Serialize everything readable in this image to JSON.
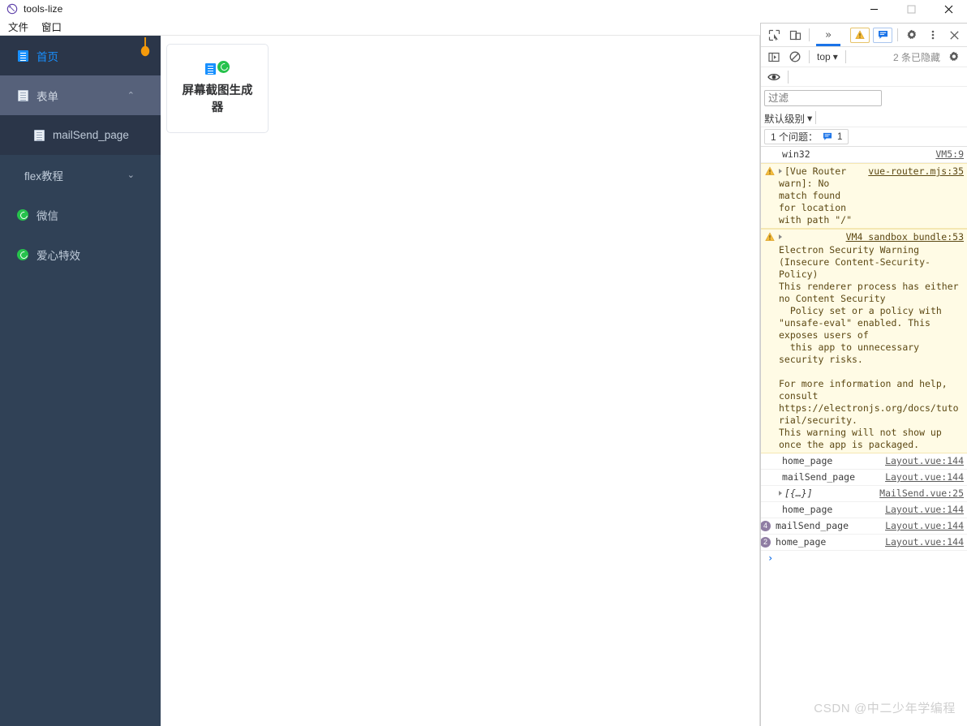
{
  "window": {
    "title": "tools-lize",
    "icon": "app-logo-icon",
    "controls": {
      "minimize": "—",
      "maximize": "☐",
      "close": "✕"
    }
  },
  "menubar": {
    "items": [
      "文件",
      "窗口"
    ]
  },
  "sidebar": {
    "items": [
      {
        "label": "首页",
        "icon": "document-icon",
        "state": "active"
      },
      {
        "label": "表单",
        "icon": "document-icon",
        "state": "group-open",
        "caret": "⌃"
      },
      {
        "label": "mailSend_page",
        "icon": "document-icon",
        "state": "sub"
      },
      {
        "label": "flex教程",
        "icon": "none",
        "state": "plain",
        "caret": "⌄"
      },
      {
        "label": "微信",
        "icon": "wechat-icon",
        "state": "plain"
      },
      {
        "label": "爱心特效",
        "icon": "wechat-icon",
        "state": "plain"
      }
    ],
    "colors": {
      "background": "#304156",
      "active_text": "#1890ff",
      "open_group_bg": "#56617a"
    }
  },
  "main": {
    "cards": [
      {
        "label": "屏幕截图生成器",
        "icons": [
          "document-icon",
          "wechat-icon"
        ]
      }
    ]
  },
  "devtools": {
    "toolbar": {
      "inspect_icon": "inspect-element-icon",
      "device_icon": "device-toolbar-icon",
      "more_tabs": "»",
      "warning_count": "",
      "message_count": "",
      "settings_icon": "gear-icon",
      "more_icon": "kebab-menu-icon",
      "close_icon": "close-icon"
    },
    "console_bar": {
      "sidebar_icon": "console-sidebar-icon",
      "clear_icon": "clear-console-icon",
      "context": "top",
      "context_caret": "▾",
      "hidden_text": "2 条已隐藏",
      "settings_icon": "gear-icon",
      "eye_icon": "live-expression-icon"
    },
    "filter": {
      "value": "",
      "placeholder": "过滤"
    },
    "level": {
      "label": "默认级别",
      "caret": "▾"
    },
    "issues": {
      "label": "1 个问题：",
      "count": "1",
      "icon": "message-icon"
    },
    "console_rows": [
      {
        "kind": "plain",
        "text": "win32",
        "source": "VM5:9"
      },
      {
        "kind": "warning",
        "expandable": true,
        "text": "[Vue Router warn]: No match found for location with path \"/\"",
        "source": "vue-router.mjs:35"
      },
      {
        "kind": "warning",
        "expandable": true,
        "text": "Electron Security Warning (Insecure Content-Security-Policy)\nThis renderer process has either no Content Security\n  Policy set or a policy with \"unsafe-eval\" enabled. This exposes users of\n  this app to unnecessary security risks.\n\nFor more information and help, consult\nhttps://electronjs.org/docs/tutorial/security.\nThis warning will not show up once the app is packaged.",
        "link": "https://electronjs.org/docs/tutorial/security",
        "source": "VM4 sandbox bundle:53"
      },
      {
        "kind": "plain",
        "text": "home_page",
        "source": "Layout.vue:144"
      },
      {
        "kind": "plain",
        "text": "mailSend_page",
        "source": "Layout.vue:144"
      },
      {
        "kind": "object",
        "expandable": true,
        "text": "[{…}]",
        "source": "MailSend.vue:25"
      },
      {
        "kind": "plain",
        "text": "home_page",
        "source": "Layout.vue:144"
      },
      {
        "kind": "plain",
        "text": "mailSend_page",
        "source": "Layout.vue:144",
        "repeat": "4"
      },
      {
        "kind": "plain",
        "text": "home_page",
        "source": "Layout.vue:144",
        "repeat": "2"
      }
    ],
    "prompt": "›"
  },
  "watermark": "CSDN @中二少年学编程"
}
